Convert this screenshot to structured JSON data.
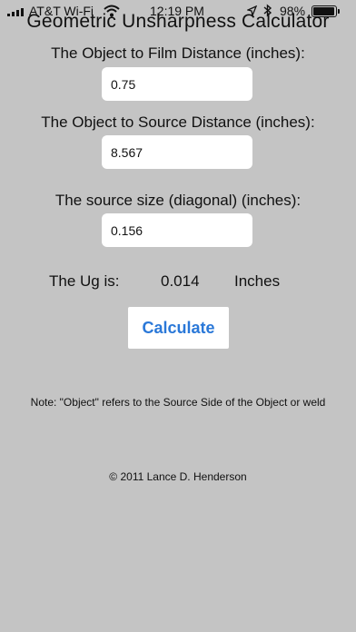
{
  "status_bar": {
    "carrier": "AT&T Wi-Fi",
    "time": "12:19 PM",
    "battery": "98%"
  },
  "app": {
    "title": "Geometric Unsharpness Calculator"
  },
  "fields": {
    "object_to_film": {
      "label": "The Object to Film Distance (inches):",
      "value": "0.75"
    },
    "object_to_source": {
      "label": "The Object to Source Distance (inches):",
      "value": "8.567"
    },
    "source_size": {
      "label": "The source size (diagonal) (inches):",
      "value": "0.156"
    }
  },
  "result": {
    "label": "The Ug is:",
    "value": "0.014",
    "unit": "Inches"
  },
  "calculate_label": "Calculate",
  "note": "Note: \"Object\" refers to the Source Side of the Object or weld",
  "copyright": "© 2011 Lance D. Henderson",
  "colors": {
    "background": "#c4c4c4",
    "button_text": "#2a78d8",
    "field_bg": "#ffffff"
  },
  "icons": [
    "signal-bars-icon",
    "wifi-icon",
    "location-arrow-icon",
    "bluetooth-icon",
    "battery-icon"
  ]
}
